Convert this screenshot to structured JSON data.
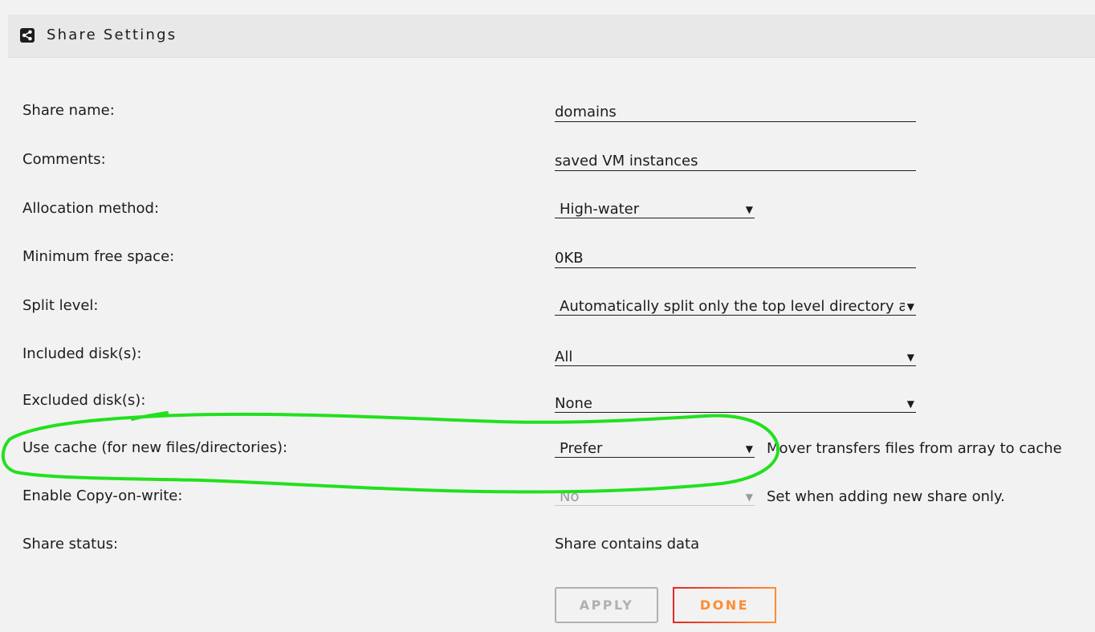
{
  "header": {
    "title": "Share Settings",
    "icon": "share-icon"
  },
  "fields": {
    "share_name": {
      "label": "Share name:",
      "value": "domains"
    },
    "comments": {
      "label": "Comments:",
      "value": "saved VM instances"
    },
    "allocation": {
      "label": "Allocation method:",
      "value": "High-water"
    },
    "min_free": {
      "label": "Minimum free space:",
      "value": "0KB"
    },
    "split": {
      "label": "Split level:",
      "value": "Automatically split only the top level directory as"
    },
    "included": {
      "label": "Included disk(s):",
      "value": "All"
    },
    "excluded": {
      "label": "Excluded disk(s):",
      "value": "None"
    },
    "cache": {
      "label": "Use cache (for new files/directories):",
      "value": "Prefer",
      "note": "Mover transfers files from array to cache"
    },
    "cow": {
      "label": "Enable Copy-on-write:",
      "value": "No",
      "note": "Set when adding new share only."
    },
    "status": {
      "label": "Share status:",
      "value": "Share contains data"
    }
  },
  "buttons": {
    "apply": "APPLY",
    "done": "DONE"
  },
  "colors": {
    "highlight": "#22e01e",
    "done_start": "#e22828",
    "done_end": "#ff8c2f"
  }
}
